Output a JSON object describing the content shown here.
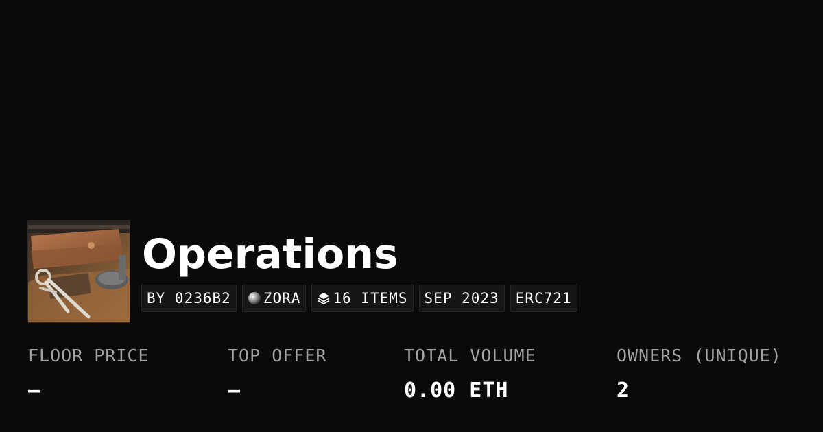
{
  "collection": {
    "title": "Operations",
    "creator": "BY 0236B2",
    "chain": "ZORA",
    "items": "16 ITEMS",
    "date": "SEP 2023",
    "standard": "ERC721"
  },
  "icons": {
    "chain": "sphere-icon",
    "items": "layers-icon"
  },
  "stats": [
    {
      "label": "FLOOR PRICE",
      "value": "–"
    },
    {
      "label": "TOP OFFER",
      "value": "–"
    },
    {
      "label": "TOTAL VOLUME",
      "value": "0.00 ETH"
    },
    {
      "label": "OWNERS (UNIQUE)",
      "value": "2"
    }
  ],
  "colors": {
    "background": "#0a0a0a",
    "chip_background": "#161616",
    "label": "#a3a3a3",
    "text": "#ffffff"
  }
}
